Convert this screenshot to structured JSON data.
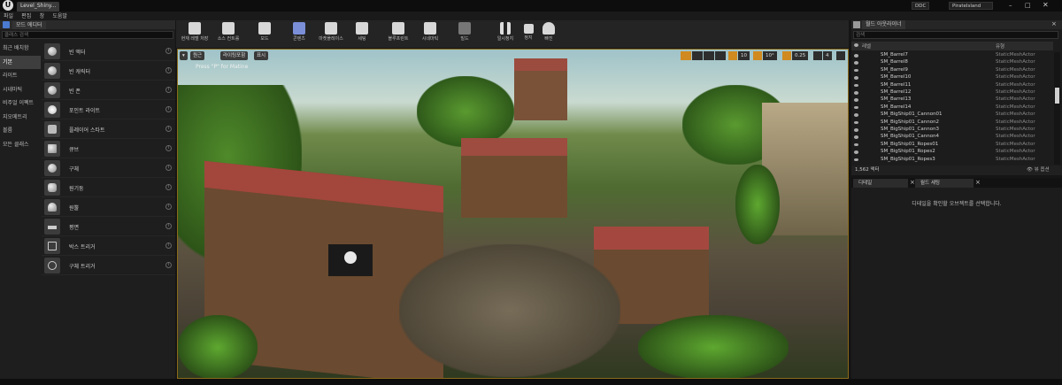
{
  "app": {
    "tab_title": "Level_Shiny...",
    "project_name": "PirateIsland",
    "source_control": "DDC"
  },
  "menu": [
    "파일",
    "편집",
    "창",
    "도움말"
  ],
  "modes": {
    "header": "모드 에디터",
    "search_placeholder": "클래스 검색",
    "categories": [
      {
        "label": "최근 배치함",
        "active": false
      },
      {
        "label": "기본",
        "active": true
      },
      {
        "label": "라이트",
        "active": false
      },
      {
        "label": "시네마틱",
        "active": false
      },
      {
        "label": "비주얼 이펙트",
        "active": false
      },
      {
        "label": "지오메트리",
        "active": false
      },
      {
        "label": "볼륨",
        "active": false
      },
      {
        "label": "모든 클래스",
        "active": false
      }
    ],
    "items": [
      {
        "label": "빈 액터",
        "icon": "sphere-icon"
      },
      {
        "label": "빈 캐릭터",
        "icon": "sphere-icon"
      },
      {
        "label": "빈 폰",
        "icon": "sphere-icon"
      },
      {
        "label": "포인트 라이트",
        "icon": "light-icon"
      },
      {
        "label": "플레이어 스타트",
        "icon": "player-icon"
      },
      {
        "label": "큐브",
        "icon": "cube-icon"
      },
      {
        "label": "구체",
        "icon": "sphere-icon"
      },
      {
        "label": "원기둥",
        "icon": "cylinder-icon"
      },
      {
        "label": "원뿔",
        "icon": "cone-icon"
      },
      {
        "label": "평면",
        "icon": "plane-icon"
      },
      {
        "label": "박스 트리거",
        "icon": "box-trigger-icon"
      },
      {
        "label": "구체 트리거",
        "icon": "sphere-trigger-icon"
      }
    ]
  },
  "toolbar": {
    "buttons": [
      {
        "label": "현재 레벨 저장",
        "icon": "save-icon"
      },
      {
        "label": "소스 컨트롤",
        "icon": "source-control-icon"
      },
      {
        "label": "모드",
        "icon": "modes-icon"
      },
      {
        "label": "콘텐츠",
        "icon": "content-icon"
      },
      {
        "label": "마켓플레이스",
        "icon": "marketplace-icon"
      },
      {
        "label": "세팅",
        "icon": "settings-icon"
      },
      {
        "label": "블루프린트",
        "icon": "blueprint-icon"
      },
      {
        "label": "시네마틱",
        "icon": "cinematics-icon"
      },
      {
        "label": "빌드",
        "icon": "build-icon"
      },
      {
        "label": "일시정지",
        "icon": "pause-icon"
      },
      {
        "label": "정지",
        "icon": "stop-icon"
      },
      {
        "label": "빠진",
        "icon": "eject-icon"
      }
    ]
  },
  "viewport": {
    "perspective_label": "원근",
    "lit_label": "라이팅포함",
    "show_label": "표시",
    "hint": "Press \"P\" for Matine",
    "grid_value": "10",
    "rotation_value": "10°",
    "scale_value": "0.25",
    "camera_speed": "4"
  },
  "outliner": {
    "tab_label": "월드 아웃라이너",
    "search_placeholder": "검색",
    "col_label": "레벨",
    "col_type": "유형",
    "rows": [
      {
        "name": "SM_Barrel7",
        "type": "StaticMeshActor"
      },
      {
        "name": "SM_Barrel8",
        "type": "StaticMeshActor"
      },
      {
        "name": "SM_Barrel9",
        "type": "StaticMeshActor"
      },
      {
        "name": "SM_Barrel10",
        "type": "StaticMeshActor"
      },
      {
        "name": "SM_Barrel11",
        "type": "StaticMeshActor"
      },
      {
        "name": "SM_Barrel12",
        "type": "StaticMeshActor"
      },
      {
        "name": "SM_Barrel13",
        "type": "StaticMeshActor"
      },
      {
        "name": "SM_Barrel14",
        "type": "StaticMeshActor"
      },
      {
        "name": "SM_BigShip01_Cannon01",
        "type": "StaticMeshActor"
      },
      {
        "name": "SM_BigShip01_Cannon2",
        "type": "StaticMeshActor"
      },
      {
        "name": "SM_BigShip01_Cannon3",
        "type": "StaticMeshActor"
      },
      {
        "name": "SM_BigShip01_Cannon4",
        "type": "StaticMeshActor"
      },
      {
        "name": "SM_BigShip01_Ropes01",
        "type": "StaticMeshActor"
      },
      {
        "name": "SM_BigShip01_Ropes2",
        "type": "StaticMeshActor"
      },
      {
        "name": "SM_BigShip01_Ropes3",
        "type": "StaticMeshActor"
      }
    ],
    "count": "1,562 액터",
    "view_options": "뷰 옵션"
  },
  "details": {
    "tab_details": "디테일",
    "tab_world_settings": "월드 세팅",
    "empty_message": "디테일을 확인할 오브젝트를 선택합니다."
  },
  "colors": {
    "accent": "#f0a020",
    "selection_border": "#8a6a1a"
  }
}
